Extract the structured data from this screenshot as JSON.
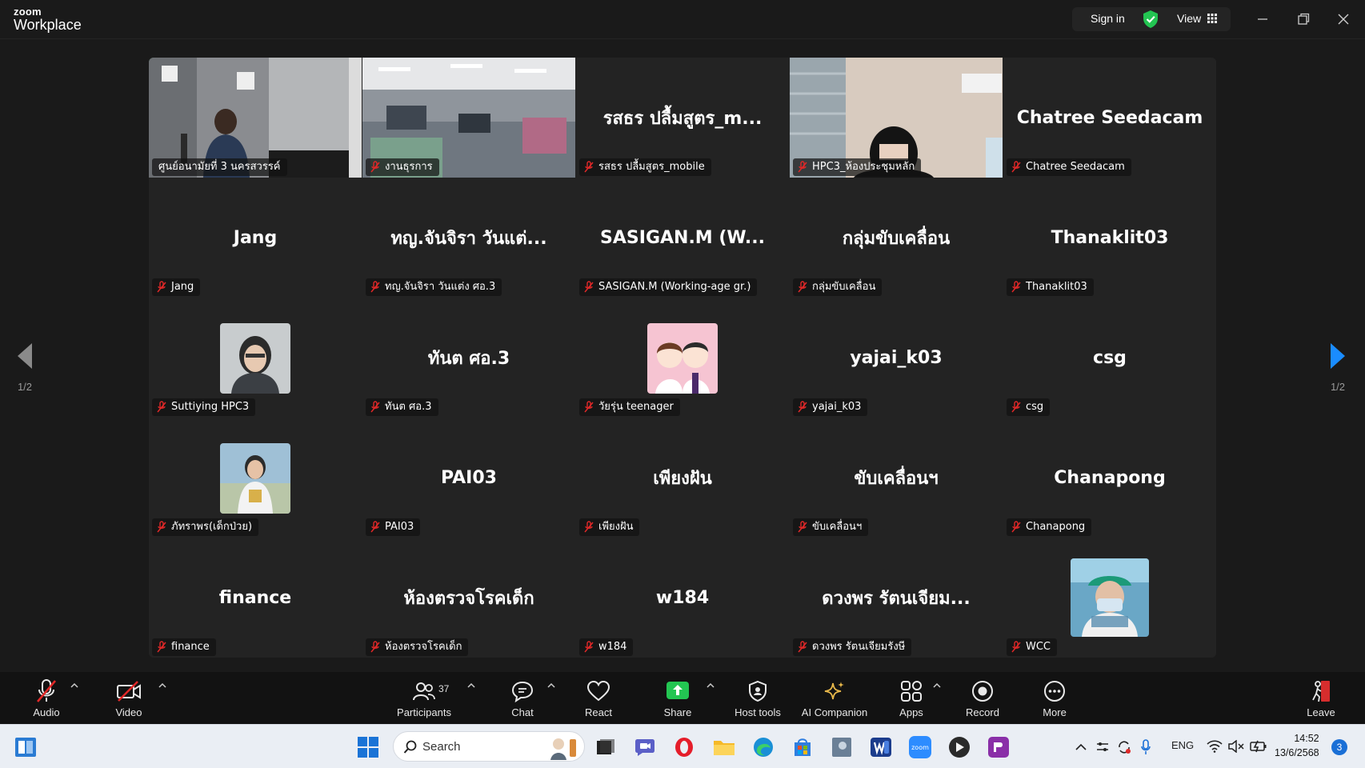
{
  "titlebar": {
    "logo_top": "zoom",
    "logo_bottom": "Workplace",
    "signin_label": "Sign in",
    "view_label": "View"
  },
  "gallery": {
    "page_left": "1/2",
    "page_right": "1/2",
    "tiles": [
      {
        "display": "",
        "name": "ศูนย์อนามัยที่ 3 นครสวรรค์"
      },
      {
        "display": "",
        "name": "งานธุรการ"
      },
      {
        "display": "รสธร ปลื้มสูตร_m...",
        "name": "รสธร ปลื้มสูตร_mobile"
      },
      {
        "display": "",
        "name": "HPC3_ห้องประชุมหลัก"
      },
      {
        "display": "Chatree Seedacam",
        "name": "Chatree Seedacam"
      },
      {
        "display": "Jang",
        "name": "Jang"
      },
      {
        "display": "ทญ.จันจิรา วันแต่...",
        "name": "ทญ.จันจิรา วันแต่ง ศอ.3"
      },
      {
        "display": "SASIGAN.M (W...",
        "name": "SASIGAN.M (Working-age gr.)"
      },
      {
        "display": "กลุ่มขับเคลื่อน",
        "name": "กลุ่มขับเคลื่อน"
      },
      {
        "display": "Thanaklit03",
        "name": "Thanaklit03"
      },
      {
        "display": "",
        "name": "Suttiying HPC3"
      },
      {
        "display": "ทันต ศอ.3",
        "name": "ทันต ศอ.3"
      },
      {
        "display": "",
        "name": "วัยรุ่น teenager"
      },
      {
        "display": "yajai_k03",
        "name": "yajai_k03"
      },
      {
        "display": "csg",
        "name": "csg"
      },
      {
        "display": "",
        "name": "ภัทราพร(เด็กป่วย)"
      },
      {
        "display": "PAI03",
        "name": "PAI03"
      },
      {
        "display": "เพียงฝัน",
        "name": "เพียงฝัน"
      },
      {
        "display": "ขับเคลื่อนฯ",
        "name": "ขับเคลื่อนฯ"
      },
      {
        "display": "Chanapong",
        "name": "Chanapong"
      },
      {
        "display": "finance",
        "name": "finance"
      },
      {
        "display": "ห้องตรวจโรคเด็ก",
        "name": "ห้องตรวจโรคเด็ก"
      },
      {
        "display": "w184",
        "name": "w184"
      },
      {
        "display": "ดวงพร รัตนเจียม...",
        "name": "ดวงพร รัตนเจียมรังษี"
      },
      {
        "display": "",
        "name": "WCC"
      }
    ]
  },
  "toolbar": {
    "audio": "Audio",
    "video": "Video",
    "participants": "Participants",
    "participants_count": "37",
    "chat": "Chat",
    "react": "React",
    "share": "Share",
    "host_tools": "Host tools",
    "ai_companion": "AI Companion",
    "apps": "Apps",
    "record": "Record",
    "more": "More",
    "leave": "Leave"
  },
  "taskbar": {
    "search_placeholder": "Search",
    "language": "ENG",
    "time": "14:52",
    "date": "13/6/2568",
    "notification_count": "3"
  },
  "colors": {
    "active_speaker_border": "#2fb355",
    "share_green": "#23c552",
    "muted_red": "#e02828",
    "pager_blue": "#1a8cff"
  }
}
